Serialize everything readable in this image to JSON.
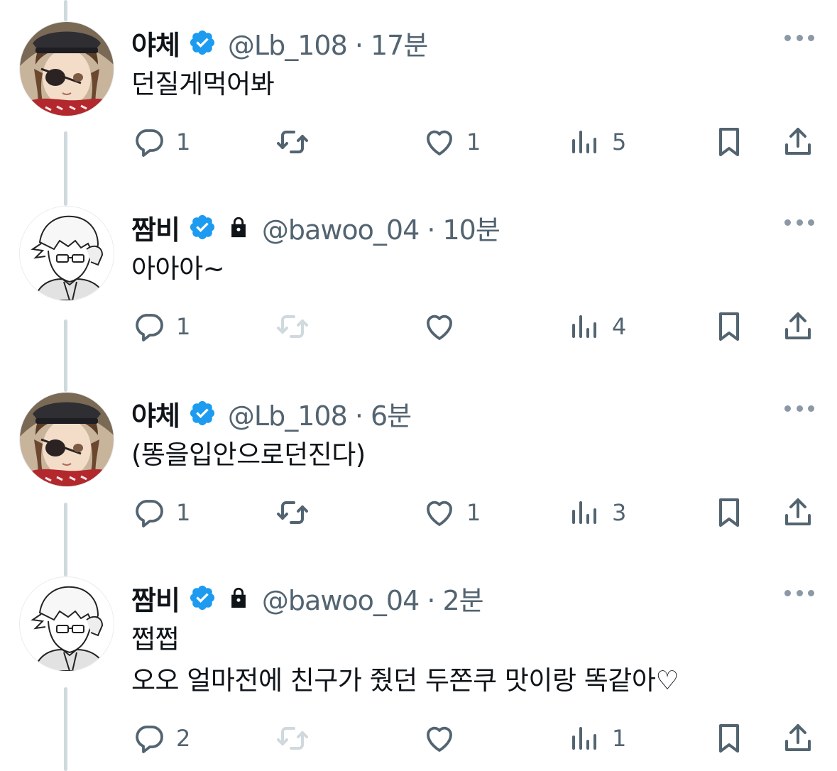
{
  "tweets": [
    {
      "name": "야체",
      "verified": true,
      "locked": false,
      "handle": "@Lb_108 · 17분",
      "avatar": "avatar-girl-eyepatch",
      "text_lines": [
        "던질게먹어봐"
      ],
      "replies": "1",
      "retweets": "",
      "retweet_enabled": true,
      "likes": "1",
      "views": "5"
    },
    {
      "name": "짬비",
      "verified": true,
      "locked": true,
      "handle": "@bawoo_04 · 10분",
      "avatar": "avatar-sketch-boy",
      "text_lines": [
        "아아아~"
      ],
      "replies": "1",
      "retweets": "",
      "retweet_enabled": false,
      "likes": "",
      "views": "4"
    },
    {
      "name": "야체",
      "verified": true,
      "locked": false,
      "handle": "@Lb_108 · 6분",
      "avatar": "avatar-girl-eyepatch",
      "text_lines": [
        "(똥을입안으로던진다)"
      ],
      "replies": "1",
      "retweets": "",
      "retweet_enabled": true,
      "likes": "1",
      "views": "3"
    },
    {
      "name": "짬비",
      "verified": true,
      "locked": true,
      "handle": "@bawoo_04 · 2분",
      "avatar": "avatar-sketch-boy",
      "text_lines": [
        "쩝쩝",
        "오오 얼마전에 친구가 줬던 두쫀쿠 맛이랑 똑같아♡"
      ],
      "replies": "2",
      "retweets": "",
      "retweet_enabled": false,
      "likes": "",
      "views": "1"
    }
  ],
  "icons": {
    "reply": "reply-icon",
    "retweet": "retweet-icon",
    "like": "heart-icon",
    "views": "views-icon",
    "bookmark": "bookmark-icon",
    "share": "share-icon",
    "verified": "verified-badge-icon",
    "lock": "lock-icon",
    "more": "more-icon"
  },
  "colors": {
    "verified": "#1d9bf0",
    "icon": "#536471",
    "icon_disabled": "#cfd9de",
    "thread_line": "#cfd9de",
    "text": "#0f1419"
  }
}
